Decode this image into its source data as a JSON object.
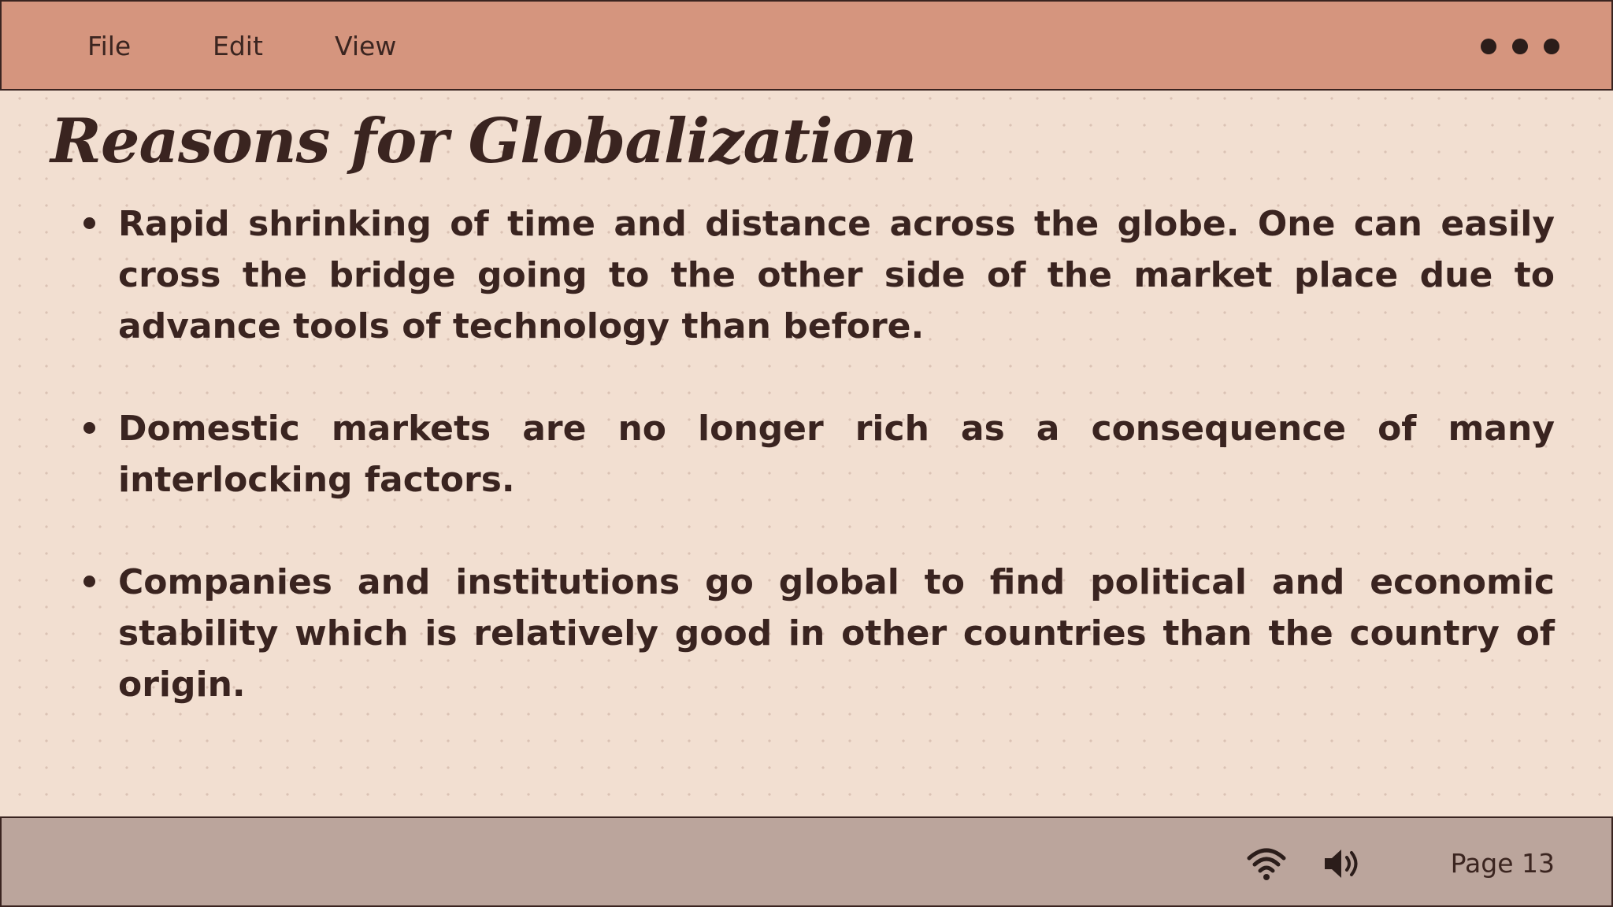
{
  "menu": {
    "file": "File",
    "edit": "Edit",
    "view": "View",
    "more_icon": "more-dots-icon"
  },
  "slide": {
    "title": "Reasons for Globalization",
    "bullets": [
      "Rapid shrinking of time and distance across the globe. One can easily cross the bridge going to the other side of the market place due to advance tools of technology than before.",
      "Domestic markets are no longer rich as a consequence of many interlocking factors.",
      "Companies and institutions go global to find political and economic stability which is relatively good in other countries than the country of origin."
    ]
  },
  "status": {
    "wifi_icon": "wifi-icon",
    "volume_icon": "volume-icon",
    "page": "Page 13"
  },
  "colors": {
    "menubar": "#d5957e",
    "background": "#f2dfd1",
    "statusbar": "#bba59c",
    "text": "#3a2420"
  }
}
